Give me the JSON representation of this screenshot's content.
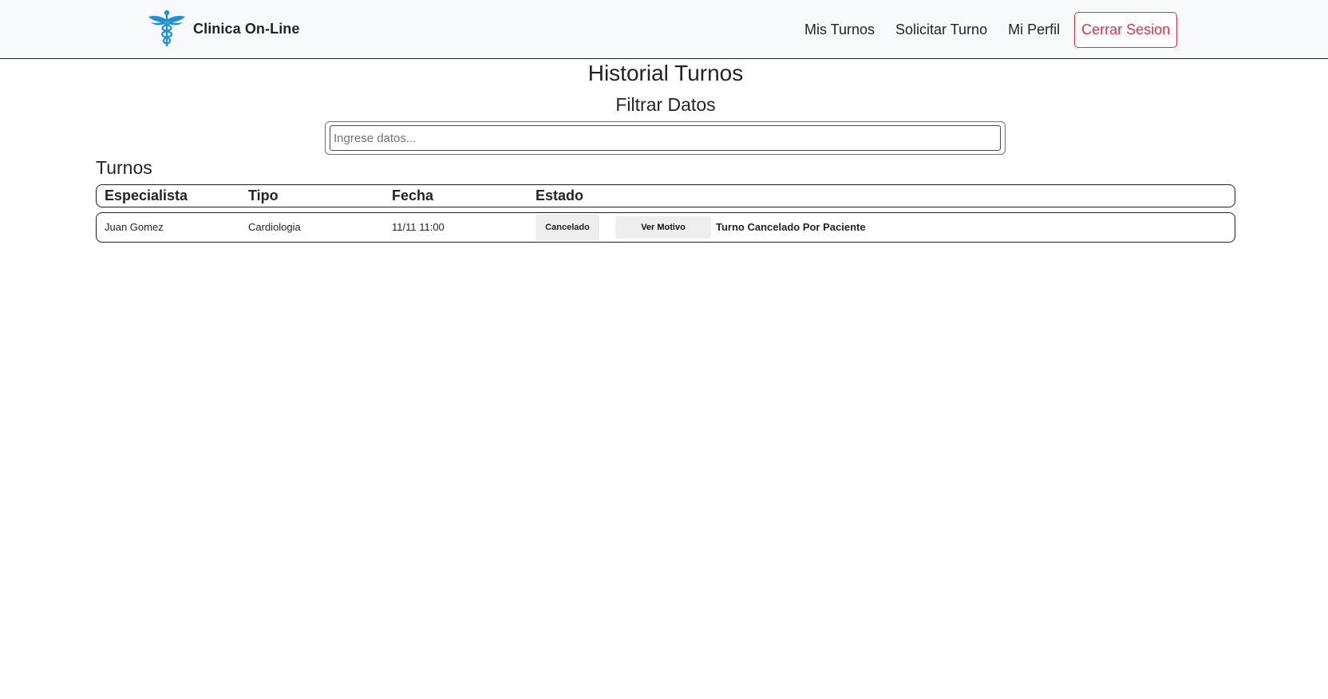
{
  "navbar": {
    "brand_name": "Clinica On-Line",
    "logo_icon": "caduceus-icon",
    "logo_color": "#1e90d6",
    "links": [
      {
        "label": "Mis Turnos"
      },
      {
        "label": "Solicitar Turno"
      },
      {
        "label": "Mi Perfil"
      }
    ],
    "logout_label": "Cerrar Sesion",
    "logout_color": "#dc3545"
  },
  "page": {
    "title": "Historial Turnos",
    "filter_title": "Filtrar Datos",
    "search_placeholder": "Ingrese datos...",
    "search_value": ""
  },
  "turnos": {
    "section_title": "Turnos",
    "columns": [
      "Especialista",
      "Tipo",
      "Fecha",
      "Estado"
    ],
    "rows": [
      {
        "especialista": "Juan Gomez",
        "tipo": "Cardiologia",
        "fecha": "11/11 11:00",
        "estado": "Cancelado",
        "action_label": "Ver Motivo",
        "motivo": "Turno Cancelado Por Paciente"
      }
    ]
  }
}
